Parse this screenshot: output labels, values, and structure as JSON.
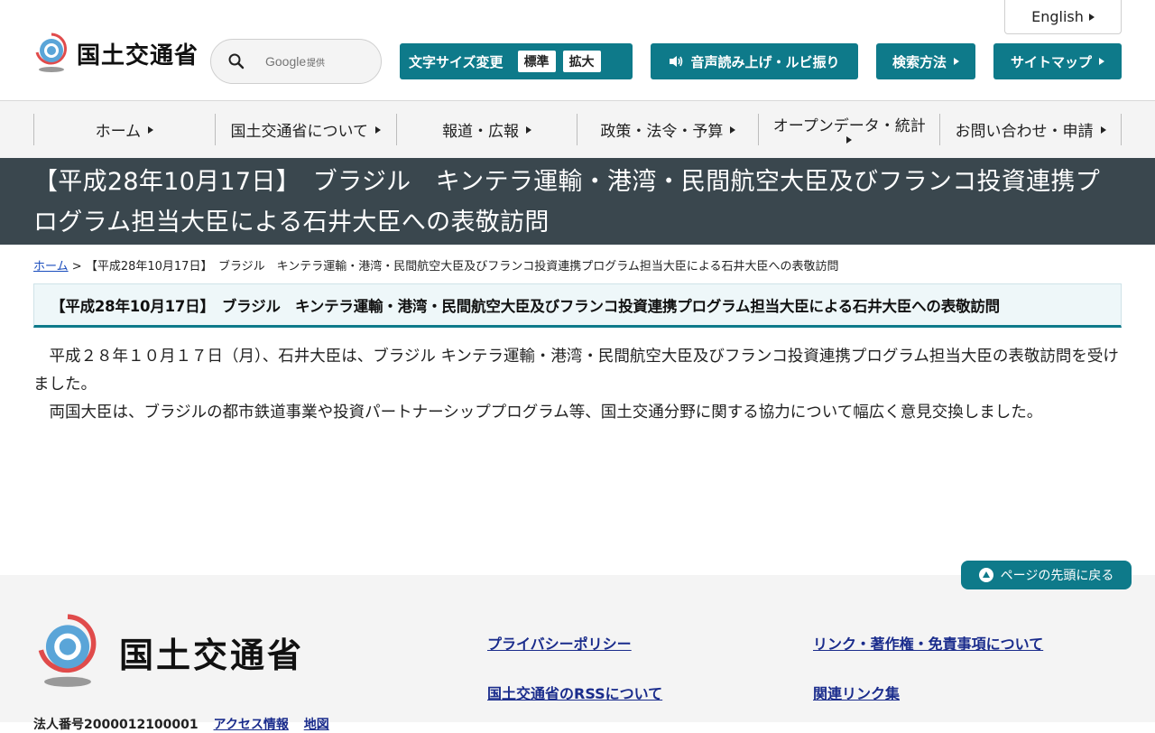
{
  "header": {
    "english_label": "English",
    "logo_text": "国土交通省",
    "search": {
      "placeholder": "Google",
      "provider": "提供"
    },
    "font_size": {
      "label": "文字サイズ変更",
      "standard": "標準",
      "large": "拡大"
    },
    "audio_label": "音声読み上げ・ルビ振り",
    "search_method_label": "検索方法",
    "sitemap_label": "サイトマップ"
  },
  "nav": {
    "items": [
      {
        "label": "ホーム"
      },
      {
        "label": "国土交通省について"
      },
      {
        "label": "報道・広報"
      },
      {
        "label": "政策・法令・予算"
      },
      {
        "label": "オープンデータ・統計"
      },
      {
        "label": "お問い合わせ・申請"
      }
    ]
  },
  "page": {
    "title": "【平成28年10月17日】　ブラジル　キンテラ運輸・港湾・民間航空大臣及びフランコ投資連携プログラム担当大臣による石井大臣への表敬訪問",
    "breadcrumb": {
      "home": "ホーム",
      "separator": ">",
      "current": "【平成28年10月17日】　ブラジル　キンテラ運輸・港湾・民間航空大臣及びフランコ投資連携プログラム担当大臣による石井大臣への表敬訪問"
    },
    "heading": "【平成28年10月17日】　ブラジル　キンテラ運輸・港湾・民間航空大臣及びフランコ投資連携プログラム担当大臣による石井大臣への表敬訪問",
    "paragraphs": [
      "　平成２８年１０月１７日（月）、石井大臣は、ブラジル キンテラ運輸・港湾・民間航空大臣及びフランコ投資連携プログラム担当大臣の表敬訪問を受けました。",
      "　両国大臣は、ブラジルの都市鉄道事業や投資パートナーシッププログラム等、国土交通分野に関する協力について幅広く意見交換しました。"
    ]
  },
  "footer": {
    "pagetop_label": "ページの先頭に戻る",
    "logo_text": "国土交通省",
    "links": {
      "privacy": "プライバシーポリシー",
      "link_copyright": "リンク・著作権・免責事項について",
      "rss": "国土交通省のRSSについて",
      "related": "関連リンク集"
    },
    "corp_number": "法人番号2000012100001",
    "access": "アクセス情報",
    "map": "地図"
  },
  "colors": {
    "teal": "#0e7a8a",
    "title_band": "#3a474e",
    "link_blue": "#1a2c8c"
  }
}
